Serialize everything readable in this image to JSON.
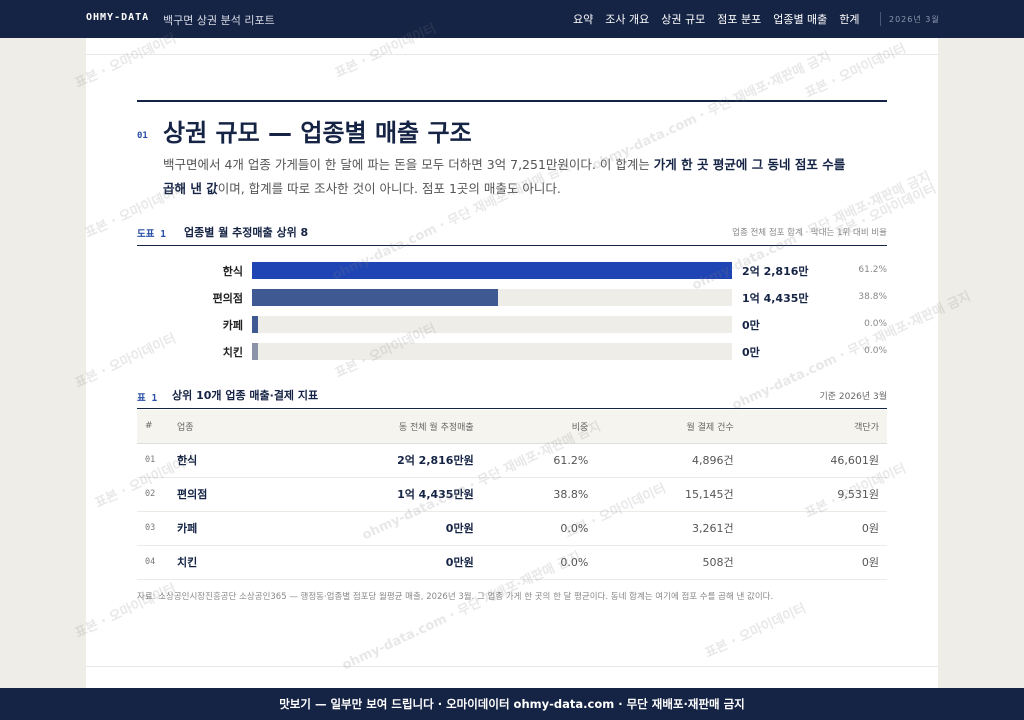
{
  "nav": {
    "brand": "OHMY-DATA",
    "report_title": "백구면 상권 분석 리포트",
    "links": [
      "요약",
      "조사 개요",
      "상권 규모",
      "점포 분포",
      "업종별 매출",
      "한계"
    ],
    "date": "2026년 3월"
  },
  "section": {
    "number": "01",
    "title": "상권 규모 — 업종별 매출 구조",
    "lede_1": "백구면에서 4개 업종 가게들이 한 달에 파는 돈을 모두 더하면 3억 7,251만원이다. 이 합계는 ",
    "lede_b1": "가게 한 곳 평균에 그 동네 점포 수를 곱해 낸 값",
    "lede_2": "이며, 합계를 따로 조사한 것이 아니다. 점포 1곳의 매출도 아니다."
  },
  "figure": {
    "label": "도표 1",
    "title": "업종별 월 추정매출 상위 8",
    "note": "업종 전체 점포 합계 · 막대는 1위 대비 비율"
  },
  "chart_data": {
    "type": "bar",
    "orientation": "horizontal",
    "categories": [
      "한식",
      "편의점",
      "카페",
      "치킨"
    ],
    "values": [
      28160,
      14435,
      0,
      0
    ],
    "unit": "만원",
    "value_labels": [
      "2억 2,816만",
      "1억 4,435만",
      "0만",
      "0만"
    ],
    "pct_labels": [
      "61.2%",
      "38.8%",
      "0.0%",
      "0.0%"
    ],
    "ratio_to_top": [
      1.0,
      0.633,
      0.0,
      0.0
    ],
    "colors": [
      "#1f45b5",
      "#3f5a92",
      "#3f5a92",
      "#8a93a8"
    ]
  },
  "table": {
    "label": "표 1",
    "title": "상위 10개 업종 매출·결제 지표",
    "note": "기준 2026년 3월",
    "headers": [
      "#",
      "업종",
      "동 전체 월 추정매출",
      "비중",
      "월 결제 건수",
      "객단가"
    ],
    "rows": [
      [
        "01",
        "한식",
        "2억 2,816만원",
        "61.2%",
        "4,896건",
        "46,601원"
      ],
      [
        "02",
        "편의점",
        "1억 4,435만원",
        "38.8%",
        "15,145건",
        "9,531원"
      ],
      [
        "03",
        "카페",
        "0만원",
        "0.0%",
        "3,261건",
        "0원"
      ],
      [
        "04",
        "치킨",
        "0만원",
        "0.0%",
        "508건",
        "0원"
      ]
    ]
  },
  "source": "자료: 소상공인시장진흥공단 소상공인365 — 행정동·업종별 점포당 월평균 매출, 2026년 3월. 그 업종 가게 한 곳의 한 달 평균이다. 동네 합계는 여기에 점포 수를 곱해 낸 값이다.",
  "footer": "맛보기 — 일부만 보여 드립니다 · 오마이데이터 ohmy-data.com · 무단 재배포·재판매 금지",
  "watermarks": {
    "text_a": "표본 · 오마이데이터",
    "text_b": "ohmy-data.com · 무단 재배포·재판매 금지"
  }
}
